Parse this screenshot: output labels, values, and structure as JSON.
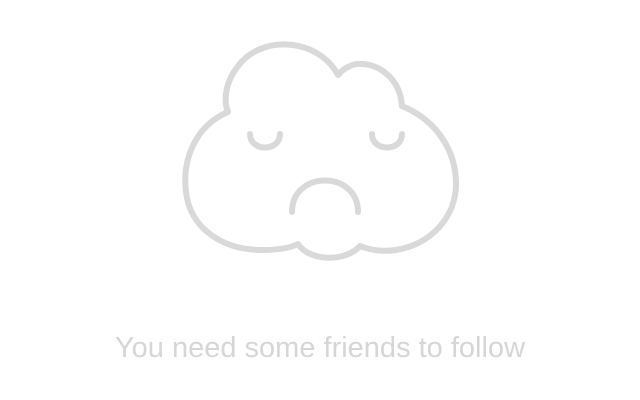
{
  "empty_state": {
    "message": "You need some friends to follow",
    "illustration_icon": "sad-cloud-icon",
    "colors": {
      "illustration": "#d9d9d9",
      "text": "#d6d6d6",
      "background": "#ffffff"
    }
  }
}
